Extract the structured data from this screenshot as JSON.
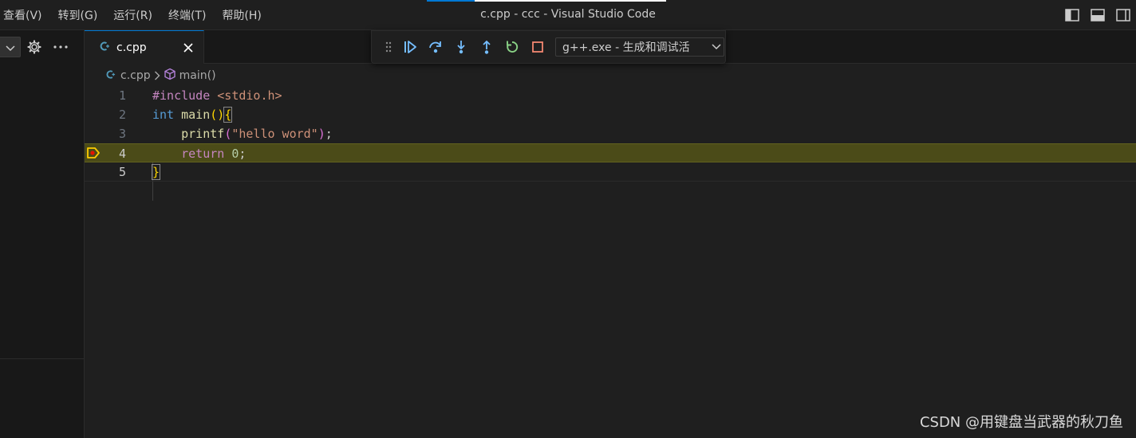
{
  "window": {
    "title": "c.cpp - ccc - Visual Studio Code"
  },
  "menu": {
    "items": [
      "查看(V)",
      "转到(G)",
      "运行(R)",
      "终端(T)",
      "帮助(H)"
    ]
  },
  "layout_controls": [
    "toggle-primary-sidebar-icon",
    "toggle-panel-icon",
    "toggle-secondary-sidebar-icon"
  ],
  "sidebar": {
    "actions": [
      "chevron-down-icon",
      "gear-icon",
      "more-icon"
    ]
  },
  "tabs": [
    {
      "label": "c.cpp",
      "icon": "cpp-file-icon",
      "active": true
    }
  ],
  "debug_toolbar": {
    "buttons": [
      "drag-grip-icon",
      "continue-icon",
      "step-over-icon",
      "step-into-icon",
      "step-out-icon",
      "restart-icon",
      "stop-icon"
    ],
    "config_selected": "g++.exe - 生成和调试活"
  },
  "breadcrumb": {
    "file": "c.cpp",
    "symbol": "main()"
  },
  "editor": {
    "current_line": 4,
    "lines": [
      {
        "number": "1",
        "tokens": [
          {
            "t": "#include ",
            "c": "tok-pre"
          },
          {
            "t": "<stdio.h>",
            "c": "tok-inc"
          }
        ]
      },
      {
        "number": "2",
        "tokens": [
          {
            "t": "int",
            "c": "tok-kw"
          },
          {
            "t": " ",
            "c": "tok-plain"
          },
          {
            "t": "main",
            "c": "tok-fn"
          },
          {
            "t": "()",
            "c": "tok-p1"
          },
          {
            "t": "{",
            "c": "tok-p1 bracket-box"
          }
        ]
      },
      {
        "number": "3",
        "tokens": [
          {
            "t": "    ",
            "c": "tok-plain"
          },
          {
            "t": "printf",
            "c": "tok-fn"
          },
          {
            "t": "(",
            "c": "tok-p2"
          },
          {
            "t": "\"hello word\"",
            "c": "tok-str"
          },
          {
            "t": ")",
            "c": "tok-p2"
          },
          {
            "t": ";",
            "c": "tok-plain"
          }
        ]
      },
      {
        "number": "4",
        "tokens": [
          {
            "t": "    ",
            "c": "tok-plain"
          },
          {
            "t": "return",
            "c": "tok-ctl"
          },
          {
            "t": " ",
            "c": "tok-plain"
          },
          {
            "t": "0",
            "c": "tok-num"
          },
          {
            "t": ";",
            "c": "tok-plain"
          }
        ]
      },
      {
        "number": "5",
        "tokens": [
          {
            "t": "}",
            "c": "tok-p1 bracket-box"
          }
        ]
      }
    ]
  },
  "watermark": "CSDN @用键盘当武器的秋刀鱼",
  "colors": {
    "accent": "#0078d4",
    "current_line_bg": "#4b4b18",
    "continue": "#75beff",
    "restart": "#89d185",
    "stop": "#f48771",
    "breakpoint_arrow": "#ffcc00",
    "breakpoint_dot": "#e51400"
  }
}
